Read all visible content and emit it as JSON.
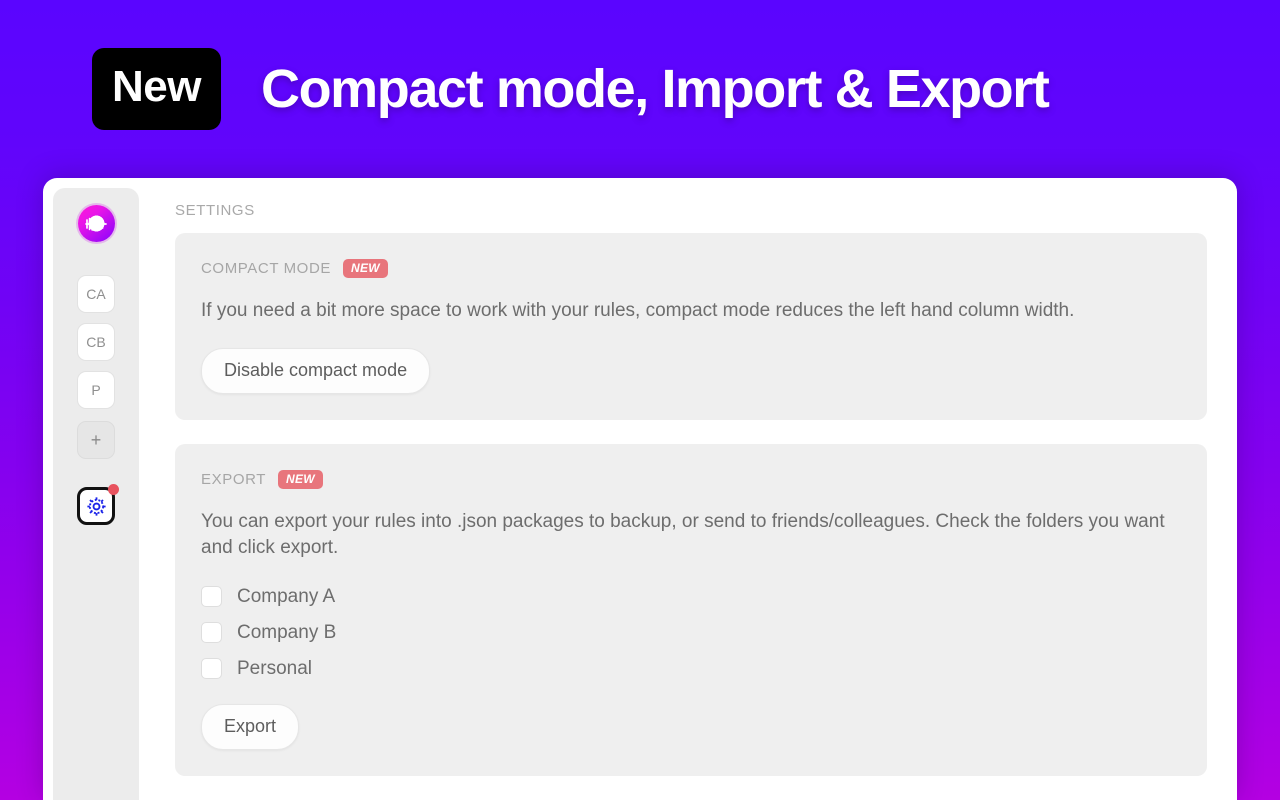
{
  "promo": {
    "badge": "New",
    "title": "Compact mode, Import & Export"
  },
  "app": {
    "sidebar": {
      "logo_name": "app-logo",
      "folders": [
        {
          "label": "CA",
          "name": "sidebar-folder-ca"
        },
        {
          "label": "CB",
          "name": "sidebar-folder-cb"
        },
        {
          "label": "P",
          "name": "sidebar-folder-p"
        }
      ],
      "add_label": "+",
      "settings_name": "settings-gear",
      "has_notification": true
    },
    "page_title": "SETTINGS",
    "sections": [
      {
        "title": "COMPACT MODE",
        "badge": "NEW",
        "body": "If you need a bit more space to work with your rules, compact mode reduces the left hand column width.",
        "button": "Disable compact mode"
      },
      {
        "title": "EXPORT",
        "badge": "NEW",
        "body": "You can export your rules into .json packages to backup, or send to friends/colleagues. Check the folders you want and click export.",
        "checkboxes": [
          {
            "label": "Company A",
            "checked": false
          },
          {
            "label": "Company B",
            "checked": false
          },
          {
            "label": "Personal",
            "checked": false
          }
        ],
        "button": "Export"
      }
    ]
  },
  "colors": {
    "gradient_top": "#5a05ff",
    "gradient_bottom": "#b400e2",
    "badge_new": "#e8757c",
    "notification_dot": "#e8525e",
    "card_bg": "#efefef",
    "sidebar_bg": "#ececec"
  }
}
